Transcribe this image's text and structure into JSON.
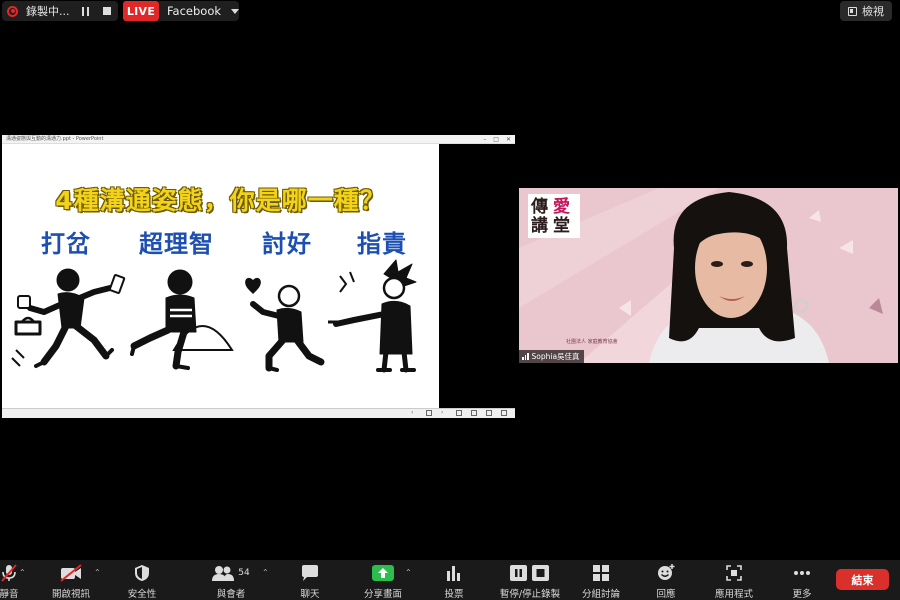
{
  "top_bar": {
    "recording_label": "錄製中...",
    "live_badge": "LIVE",
    "stream_target": "Facebook",
    "view_button": "檢視"
  },
  "shared_screen": {
    "window_title": "溝通姿態與互動的溝通力.ppt - PowerPoint",
    "slide_title": "4種溝通姿態，你是哪一種？",
    "styles": [
      "打岔",
      "超理智",
      "討好",
      "指責"
    ]
  },
  "participant": {
    "name": "Sophia吳佳真",
    "logo": [
      "傳",
      "愛",
      "講",
      "堂"
    ]
  },
  "toolbar": {
    "items": [
      {
        "label": "靜音",
        "icon": "mic-icon",
        "has_caret": true
      },
      {
        "label": "開啟視訊",
        "icon": "video-off-icon",
        "has_caret": true
      },
      {
        "label": "安全性",
        "icon": "shield-icon",
        "has_caret": false
      },
      {
        "label": "與會者",
        "icon": "participants-icon",
        "count": "54",
        "has_caret": true
      },
      {
        "label": "聊天",
        "icon": "chat-icon",
        "has_caret": false
      },
      {
        "label": "分享畫面",
        "icon": "share-screen-icon",
        "has_caret": true,
        "accent": "#2dbd4e"
      },
      {
        "label": "投票",
        "icon": "poll-icon",
        "has_caret": false
      },
      {
        "label": "暫停/停止錄製",
        "icon": "pause-stop-icon",
        "has_caret": false
      },
      {
        "label": "分組討論",
        "icon": "breakout-icon",
        "has_caret": false
      },
      {
        "label": "回應",
        "icon": "reaction-icon",
        "has_caret": false
      },
      {
        "label": "應用程式",
        "icon": "apps-icon",
        "has_caret": false
      },
      {
        "label": "更多",
        "icon": "more-icon",
        "has_caret": false
      }
    ],
    "end_button": "結束"
  },
  "colors": {
    "live_red": "#e02828",
    "end_red": "#d9302c",
    "share_green": "#2dbd4e",
    "slide_title_yellow": "#f2d21a",
    "slide_label_blue": "#1d4fb3",
    "video_bg_pink": "#eac7ce"
  }
}
